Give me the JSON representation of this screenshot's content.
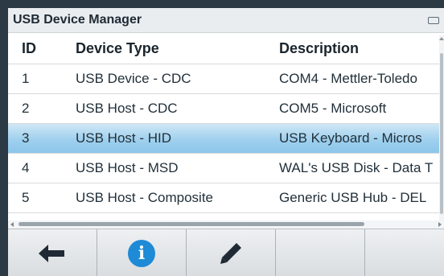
{
  "window": {
    "title": "USB Device Manager"
  },
  "table": {
    "headers": {
      "id": "ID",
      "type": "Device Type",
      "desc": "Description"
    },
    "rows": [
      {
        "id": "1",
        "type": "USB Device - CDC",
        "desc": "COM4 - Mettler-Toledo"
      },
      {
        "id": "2",
        "type": "USB Host - CDC",
        "desc": "COM5 - Microsoft"
      },
      {
        "id": "3",
        "type": "USB Host - HID",
        "desc": "USB Keyboard - Micros"
      },
      {
        "id": "4",
        "type": "USB Host - MSD",
        "desc": "WAL's USB Disk - Data T"
      },
      {
        "id": "5",
        "type": "USB Host - Composite",
        "desc": "Generic USB Hub - DEL"
      }
    ],
    "selected_row_id": "3"
  },
  "softkeys": [
    {
      "icon": "back-arrow-icon"
    },
    {
      "icon": "info-icon",
      "glyph": "i"
    },
    {
      "icon": "edit-pencil-icon"
    },
    {
      "icon": ""
    },
    {
      "icon": ""
    }
  ],
  "colors": {
    "selection": "#8cc6ea",
    "info_accent": "#1f8ad6",
    "bezel": "#2b3a44"
  }
}
